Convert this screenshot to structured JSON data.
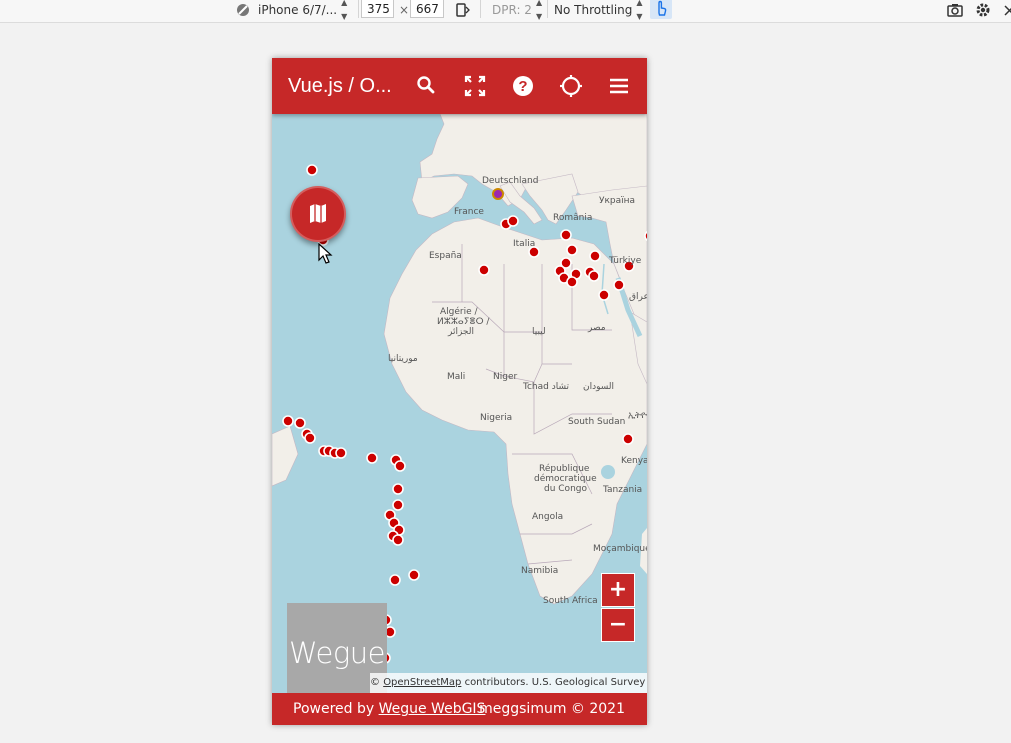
{
  "devtools": {
    "device": "iPhone 6/7/...",
    "width": "375",
    "times": "×",
    "height": "667",
    "dpr": "DPR: 2",
    "throttling": "No Throttling"
  },
  "app": {
    "title": "Vue.js / O...",
    "toolbar_icons": [
      "search-icon",
      "fullscreen-icon",
      "help-icon",
      "geolocate-icon",
      "menu-icon"
    ]
  },
  "map": {
    "labels": {
      "deutschland": "Deutschland",
      "france": "France",
      "romania": "România",
      "ukraine": "Україна",
      "espana": "España",
      "italia": "Italia",
      "turkiye": "Türkiye",
      "algerie1": "Algérie /",
      "algerie2": "ⵍⵣⵣⴰⵢⴻⵔ /",
      "algerie3": "الجزائر",
      "libya": "ليبيا",
      "misr": "مصر",
      "mauritania": "موريتانيا",
      "mali": "Mali",
      "niger": "Niger",
      "tchad": "Tchad تشاد",
      "sudan": "السودان",
      "nigeria": "Nigeria",
      "southsudan": "South Sudan",
      "ethiopia": "ኢትዮ",
      "rdc1": "République",
      "rdc2": "démocratique",
      "rdc3": "du Congo",
      "kenya": "Kenya",
      "tanzania": "Tanzania",
      "angola": "Angola",
      "mocambique": "Moçambique",
      "namibia": "Namibia",
      "southafrica": "South Africa",
      "iraq": "عراق"
    },
    "attribution_prefix": "© ",
    "attribution_link": "OpenStreetMap",
    "attribution_suffix": " contributors. U.S. Geological Survey",
    "zoom_in": "+",
    "zoom_out": "−",
    "fab_icon": "map-icon"
  },
  "logo": {
    "text": "Wegue"
  },
  "footer": {
    "powered_by": "Powered by ",
    "link": "Wegue WebGIS",
    "copyright": "meggsimum © 2021"
  },
  "colors": {
    "primary": "#c62828",
    "water": "#aad3df",
    "land": "#f2efe9",
    "marker": "#cc0000"
  }
}
